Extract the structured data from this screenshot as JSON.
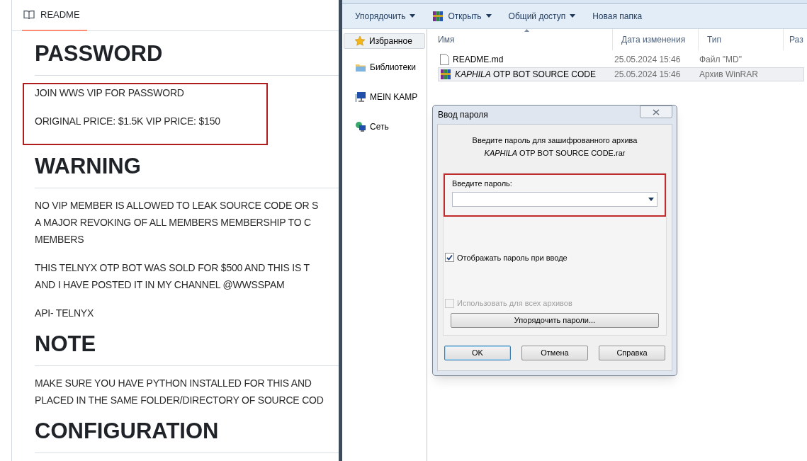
{
  "readme": {
    "tab": {
      "label": "README",
      "selected": true
    },
    "sections": [
      {
        "heading": "PASSWORD",
        "highlighted": true,
        "paragraphs": [
          [
            "JOIN WWS VIP FOR PASSWORD"
          ],
          [
            "ORIGINAL PRICE: $1.5K VIP PRICE: $150"
          ]
        ]
      },
      {
        "heading": "WARNING",
        "highlighted": false,
        "paragraphs": [
          [
            "NO VIP MEMBER IS ALLOWED TO LEAK SOURCE CODE OR S",
            "A MAJOR REVOKING OF ALL MEMBERS MEMBERSHIP TO C",
            "MEMBERS"
          ],
          [
            "THIS TELNYX OTP BOT WAS SOLD FOR $500 AND THIS IS T",
            "AND I HAVE POSTED IT IN MY CHANNEL @WWSSPAM"
          ],
          [
            "API- TELNYX"
          ]
        ]
      },
      {
        "heading": "NOTE",
        "highlighted": false,
        "paragraphs": [
          [
            "MAKE SURE YOU HAVE PYTHON INSTALLED FOR THIS AND",
            "PLACED IN THE SAME FOLDER/DIRECTORY OF SOURCE COD"
          ]
        ]
      },
      {
        "heading": "CONFIGURATION"
      }
    ]
  },
  "explorer": {
    "toolbar": [
      {
        "label": "Упорядочить",
        "kind": "menu"
      },
      {
        "label": "Открыть",
        "kind": "app-menu"
      },
      {
        "label": "Общий доступ",
        "kind": "menu"
      },
      {
        "label": "Новая папка",
        "kind": "button"
      }
    ],
    "nav": [
      {
        "label": "Избранное",
        "kind": "favorites",
        "selected": true
      },
      {
        "label": "Библиотеки",
        "kind": "libraries",
        "selected": false
      },
      {
        "label": "MEIN KAMP",
        "kind": "computer",
        "selected": false
      },
      {
        "label": "Сеть",
        "kind": "network",
        "selected": false
      }
    ],
    "columns": [
      "Имя",
      "Дата изменения",
      "Тип",
      "Раз"
    ],
    "files": [
      {
        "name": "README.md",
        "date": "25.05.2024 15:46",
        "type": "Файл \"MD\"",
        "kind": "md",
        "selected": false
      },
      {
        "name": "*KAPHILA* OTP BOT SOURCE CODE",
        "date": "25.05.2024 15:46",
        "type": "Архив WinRAR",
        "kind": "rar",
        "selected": true
      }
    ]
  },
  "dialog": {
    "title": "Ввод пароля",
    "message": [
      "Введите пароль для зашифрованного архива",
      "*KAPHILA* OTP BOT SOURCE CODE.rar"
    ],
    "password_label": "Введите пароль:",
    "highlighted": true,
    "checkboxes": [
      {
        "label": "Отображать пароль при вводе",
        "checked": true,
        "disabled": false
      },
      {
        "label": "Использовать для всех архивов",
        "checked": false,
        "disabled": true
      }
    ],
    "manage_button": "Упорядочить пароли...",
    "buttons": [
      {
        "label": "OK",
        "default": true
      },
      {
        "label": "Отмена",
        "default": false
      },
      {
        "label": "Справка",
        "default": false
      }
    ]
  }
}
